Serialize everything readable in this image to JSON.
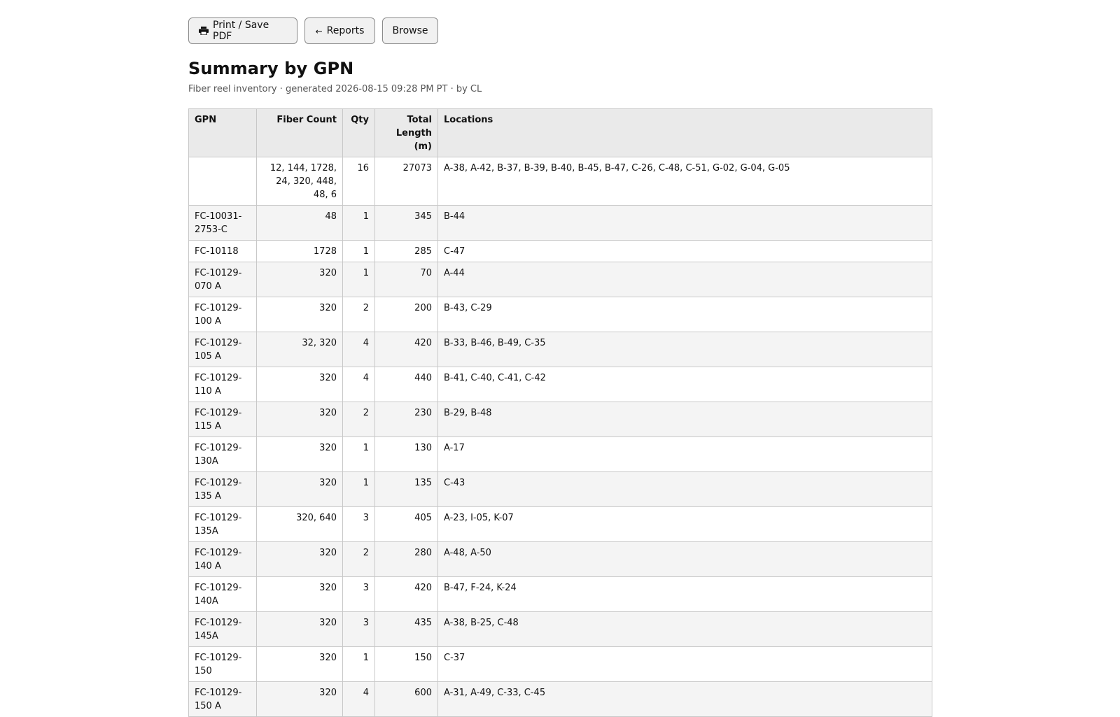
{
  "toolbar": {
    "print_label": "Print / Save PDF",
    "reports_label": "Reports",
    "reports_arrow": "←",
    "browse_label": "Browse"
  },
  "page": {
    "title": "Summary by GPN",
    "meta": "Fiber reel inventory · generated 2026-08-15 09:28 PM PT · by CL"
  },
  "table": {
    "headers": {
      "gpn": "GPN",
      "fiber_count": "Fiber Count",
      "qty": "Qty",
      "total_length": "Total Length (m)",
      "locations": "Locations"
    },
    "rows": [
      {
        "gpn": "",
        "fiber_count": "12, 144, 1728, 24, 320, 448, 48, 6",
        "qty": "16",
        "total_length": "27073",
        "locations": "A-38, A-42, B-37, B-39, B-40, B-45, B-47, C-26, C-48, C-51, G-02, G-04, G-05"
      },
      {
        "gpn": "FC-10031-2753-C",
        "fiber_count": "48",
        "qty": "1",
        "total_length": "345",
        "locations": "B-44"
      },
      {
        "gpn": "FC-10118",
        "fiber_count": "1728",
        "qty": "1",
        "total_length": "285",
        "locations": "C-47"
      },
      {
        "gpn": "FC-10129-070 A",
        "fiber_count": "320",
        "qty": "1",
        "total_length": "70",
        "locations": "A-44"
      },
      {
        "gpn": "FC-10129-100 A",
        "fiber_count": "320",
        "qty": "2",
        "total_length": "200",
        "locations": "B-43, C-29"
      },
      {
        "gpn": "FC-10129-105 A",
        "fiber_count": "32, 320",
        "qty": "4",
        "total_length": "420",
        "locations": "B-33, B-46, B-49, C-35"
      },
      {
        "gpn": "FC-10129-110 A",
        "fiber_count": "320",
        "qty": "4",
        "total_length": "440",
        "locations": "B-41, C-40, C-41, C-42"
      },
      {
        "gpn": "FC-10129-115 A",
        "fiber_count": "320",
        "qty": "2",
        "total_length": "230",
        "locations": "B-29, B-48"
      },
      {
        "gpn": "FC-10129-130A",
        "fiber_count": "320",
        "qty": "1",
        "total_length": "130",
        "locations": "A-17"
      },
      {
        "gpn": "FC-10129-135 A",
        "fiber_count": "320",
        "qty": "1",
        "total_length": "135",
        "locations": "C-43"
      },
      {
        "gpn": "FC-10129-135A",
        "fiber_count": "320, 640",
        "qty": "3",
        "total_length": "405",
        "locations": "A-23, I-05, K-07"
      },
      {
        "gpn": "FC-10129-140 A",
        "fiber_count": "320",
        "qty": "2",
        "total_length": "280",
        "locations": "A-48, A-50"
      },
      {
        "gpn": "FC-10129-140A",
        "fiber_count": "320",
        "qty": "3",
        "total_length": "420",
        "locations": "B-47, F-24, K-24"
      },
      {
        "gpn": "FC-10129-145A",
        "fiber_count": "320",
        "qty": "3",
        "total_length": "435",
        "locations": "A-38, B-25, C-48"
      },
      {
        "gpn": "FC-10129-150",
        "fiber_count": "320",
        "qty": "1",
        "total_length": "150",
        "locations": "C-37"
      },
      {
        "gpn": "FC-10129-150 A",
        "fiber_count": "320",
        "qty": "4",
        "total_length": "600",
        "locations": "A-31, A-49, C-33, C-45"
      }
    ]
  }
}
